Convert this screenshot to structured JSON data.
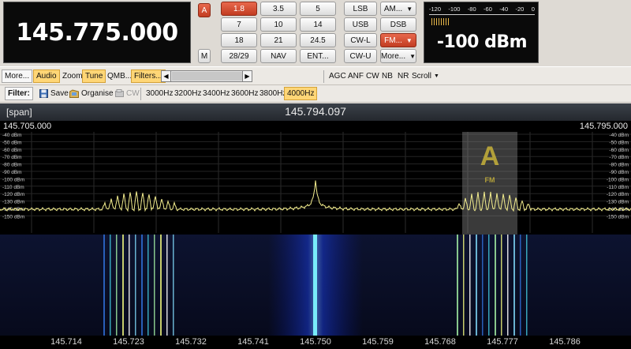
{
  "frequency_display": "145.775.000",
  "bands": {
    "a_label": "A",
    "m_label": "M",
    "buttons": [
      "1.8",
      "3.5",
      "5",
      "7",
      "10",
      "14",
      "18",
      "21",
      "24.5",
      "28/29",
      "NAV",
      "ENT..."
    ],
    "selected": "1.8"
  },
  "modes": {
    "buttons": [
      "LSB",
      "AM...",
      "USB",
      "DSB",
      "CW-L",
      "FM...",
      "CW-U",
      "More..."
    ],
    "selected": "FM..."
  },
  "smeter": {
    "scale": [
      "-120",
      "-100",
      "-80",
      "-60",
      "-40",
      "-20",
      "0"
    ],
    "value": "-100 dBm"
  },
  "toolbar": {
    "more": "More...",
    "audio": "Audio",
    "zoom": "Zoom",
    "tune": "Tune",
    "qmb": "QMB...",
    "filters": "Filters...",
    "agc": "AGC",
    "anf": "ANF",
    "cw": "CW",
    "nb": "NB",
    "nr": "NR",
    "scroll": "Scroll"
  },
  "filterbar": {
    "label": "Filter:",
    "save": "Save",
    "organise": "Organise",
    "cw": "CW",
    "filters": [
      "3000Hz",
      "3200Hz",
      "3400Hz",
      "3600Hz",
      "3800Hz",
      "4000Hz"
    ],
    "selected": "4000Hz"
  },
  "display": {
    "span_label": "[span]",
    "center_freq": "145.794.097",
    "left_freq": "145.705.000",
    "right_freq": "145.795.000",
    "db_labels": [
      "-40 dBm",
      "-50 dBm",
      "-60 dBm",
      "-70 dBm",
      "-80 dBm",
      "-90 dBm",
      "-100 dBm",
      "-110 dBm",
      "-120 dBm",
      "-130 dBm",
      "-140 dBm",
      "-150 dBm"
    ],
    "vfo_letter": "A",
    "vfo_mode": "FM",
    "freq_axis": [
      "145.714",
      "145.723",
      "145.732",
      "145.741",
      "145.750",
      "145.759",
      "145.768",
      "145.777",
      "145.786"
    ]
  },
  "colors": {
    "button_selected": "#d14a2e",
    "toolbar_highlight": "#ffd676",
    "spectrum_trace": "#f4ee8e",
    "vfo_overlay": "#8a8a8a",
    "vfo_letter": "#d9c13a"
  }
}
